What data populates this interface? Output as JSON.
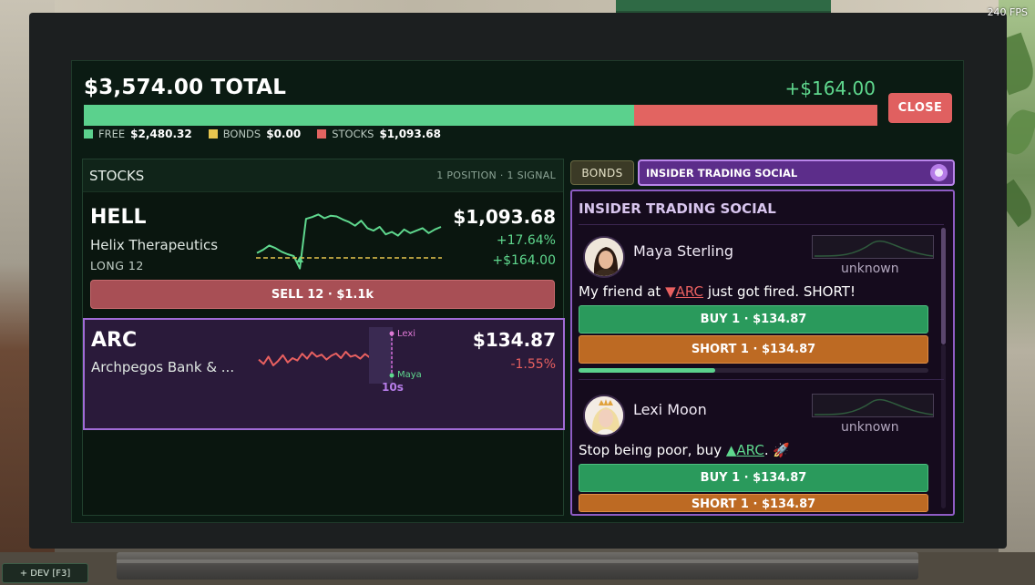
{
  "hud": {
    "fps": "240 FPS",
    "dev_button": "+ DEV [F3]"
  },
  "portfolio": {
    "total": "$3,574.00 TOTAL",
    "delta": "+$164.00",
    "close_label": "CLOSE",
    "allocation": {
      "free_fraction": 0.694,
      "bonds_fraction": 0.0,
      "stocks_fraction": 0.306
    },
    "legend": [
      {
        "label": "FREE",
        "value": "$2,480.32",
        "color": "#5bd18d"
      },
      {
        "label": "BONDS",
        "value": "$0.00",
        "color": "#e7c64f"
      },
      {
        "label": "STOCKS",
        "value": "$1,093.68",
        "color": "#e26461"
      }
    ]
  },
  "stocks": {
    "title": "STOCKS",
    "meta": "1 POSITION · 1 SIGNAL",
    "items": [
      {
        "ticker": "HELL",
        "name": "Helix Therapeutics",
        "position": "LONG 12",
        "price": "$1,093.68",
        "change_pct": "+17.64%",
        "pl": "+$164.00",
        "sell_label": "SELL 12 · $1.1k",
        "sparkline": [
          0.3,
          0.35,
          0.42,
          0.38,
          0.32,
          0.28,
          0.25,
          0.05,
          0.85,
          0.88,
          0.92,
          0.86,
          0.9,
          0.89,
          0.84,
          0.8,
          0.74,
          0.82,
          0.7,
          0.66,
          0.72,
          0.6,
          0.64,
          0.58,
          0.68,
          0.62,
          0.66,
          0.7,
          0.62,
          0.68,
          0.72
        ],
        "entry_level": 0.22
      },
      {
        "ticker": "ARC",
        "name": "Archpegos Bank & ...",
        "price": "$134.87",
        "change_pct": "-1.55%",
        "sparkline": [
          0.45,
          0.3,
          0.55,
          0.25,
          0.4,
          0.6,
          0.35,
          0.5,
          0.42,
          0.65,
          0.48,
          0.7,
          0.55,
          0.62,
          0.45,
          0.58,
          0.66,
          0.5,
          0.72,
          0.55,
          0.6,
          0.48,
          0.64,
          0.52
        ],
        "signal_top_label": "Lexi",
        "signal_bottom_label": "Maya",
        "signal_timer": "10s"
      }
    ]
  },
  "tabs": {
    "bonds": "BONDS",
    "social": "INSIDER TRADING SOCIAL"
  },
  "social": {
    "title": "INSIDER TRADING SOCIAL",
    "posts": [
      {
        "author": "Maya Sterling",
        "chart_status": "unknown",
        "text_before": "My friend at ",
        "tag_arrow": "▼",
        "tag": "ARC",
        "text_after": " just got fired. SHORT!",
        "buy_label": "BUY 1 · $134.87",
        "short_label": "SHORT 1 · $134.87",
        "timer_fraction": 0.39
      },
      {
        "author": "Lexi Moon",
        "chart_status": "unknown",
        "text_before": "Stop being poor, buy ",
        "tag_arrow": "▲",
        "tag": "ARC",
        "text_after": ". 🚀",
        "buy_label": "BUY 1 · $134.87",
        "short_label": "SHORT 1 · $134.87"
      }
    ]
  }
}
